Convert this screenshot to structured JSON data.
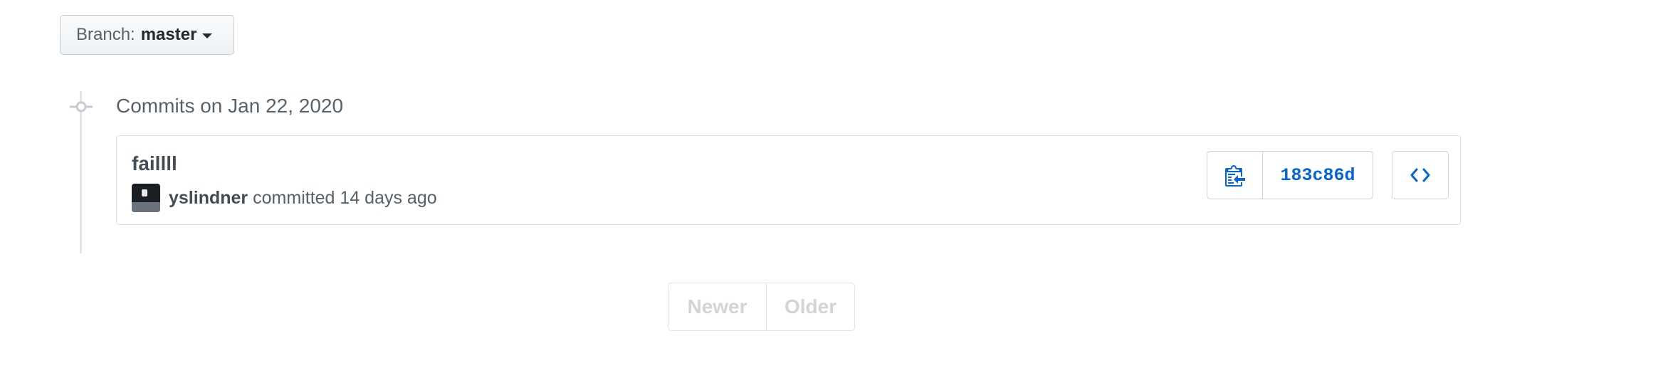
{
  "branch": {
    "prefix": "Branch:",
    "name": "master"
  },
  "timeline": {
    "group_title": "Commits on Jan 22, 2020"
  },
  "commit": {
    "message": "faillll",
    "author": "yslindner",
    "committed_text": "committed 14 days ago",
    "sha": "183c86d",
    "copy_icon": "clippy-icon",
    "browse_icon": "code-icon"
  },
  "pagination": {
    "newer": "Newer",
    "older": "Older"
  },
  "colors": {
    "link": "#0366d6",
    "muted": "#586069",
    "border": "#e1e4e8",
    "disabled": "#d1d5da"
  }
}
